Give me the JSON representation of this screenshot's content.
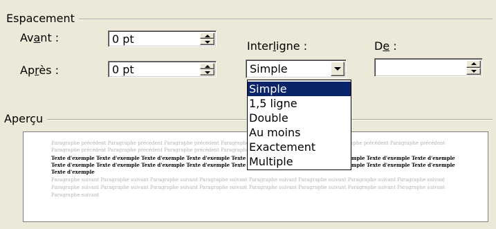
{
  "spacing": {
    "title": "Espacement",
    "before": {
      "label_pre": "Av",
      "label_u": "a",
      "label_post": "nt :",
      "value": "0 pt"
    },
    "after": {
      "label_pre": "Ap",
      "label_u": "r",
      "label_post": "ès :",
      "value": "0 pt"
    },
    "line_spacing": {
      "label_pre": "Inter",
      "label_u": "l",
      "label_post": "igne :",
      "value": "Simple",
      "options": [
        "Simple",
        "1,5 ligne",
        "Double",
        "Au moins",
        "Exactement",
        "Multiple"
      ],
      "selected_index": 0
    },
    "at": {
      "label_pre": "D",
      "label_u": "e",
      "label_post": " :",
      "value": ""
    }
  },
  "preview": {
    "title": "Aperçu",
    "lines": [
      {
        "style": "gray",
        "text": "Paragraphe précédent Paragraphe précédent Paragraphe précédent Paragraphe précédent Paragraphe précédent Paragraphe précédent Paragraphe précédent"
      },
      {
        "style": "gray",
        "text": "Paragraphe précédent Paragraphe précédent Paragraphe précédent Paragraphe précédent Paragraphe précédent"
      },
      {
        "style": "dark",
        "text": "Texte d'exemple Texte d'exemple Texte d'exemple Texte d'exemple Texte d'exemple Texte d'exemple Texte d'exemple Texte d'exemple Texte d'exemple"
      },
      {
        "style": "dark",
        "text": "Texte d'exemple Texte d'exemple Texte d'exemple Texte d'exemple Texte d'exemple Texte d'exemple Texte d'exemple Texte d'exemple Texte d'exemple"
      },
      {
        "style": "dark",
        "text": "Texte d'exemple"
      },
      {
        "style": "gray",
        "text": "Paragraphe suivant Paragraphe suivant Paragraphe suivant Paragraphe suivant Paragraphe suivant Paragraphe suivant Paragraphe suivant Paragraphe suivant"
      },
      {
        "style": "gray",
        "text": "Paragraphe suivant Paragraphe suivant Paragraphe suivant Paragraphe suivant Paragraphe suivant Paragraphe suivant Paragraphe suivant Paragraphe suivant"
      },
      {
        "style": "gray",
        "text": "Paragraphe suivant"
      }
    ]
  },
  "colors": {
    "dialog_bg": "#ECE9D8",
    "selection": "#0A246A",
    "preview_gray_text": "#B4B4B4"
  },
  "icons": [
    "spin-up-icon",
    "spin-down-icon",
    "dropdown-arrow-icon"
  ]
}
